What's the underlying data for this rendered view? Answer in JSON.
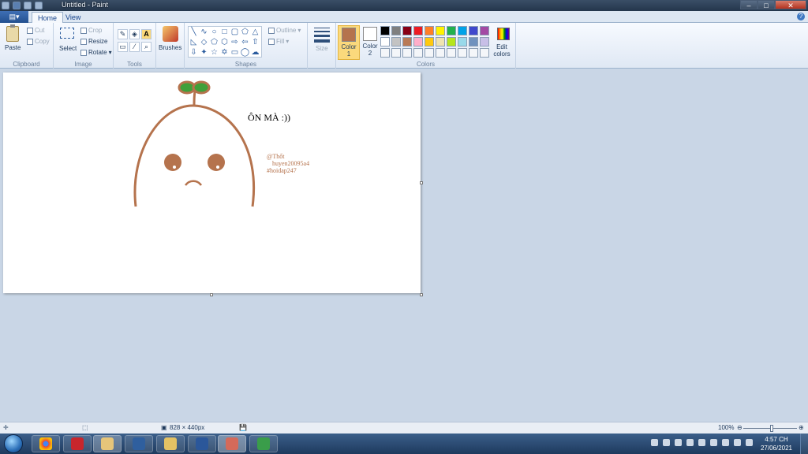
{
  "window": {
    "title": "Untitled - Paint",
    "controls": {
      "minimize": "–",
      "maximize": "□",
      "close": "✕"
    }
  },
  "ribbon_tabs": [
    {
      "label": "Home",
      "active": true
    },
    {
      "label": "View",
      "active": false
    }
  ],
  "clipboard": {
    "paste": "Paste",
    "cut": "Cut",
    "copy": "Copy",
    "group": "Clipboard"
  },
  "image": {
    "select": "Select",
    "crop": "Crop",
    "resize": "Resize",
    "rotate": "Rotate",
    "group": "Image"
  },
  "tools": {
    "group": "Tools",
    "text_tool": "A"
  },
  "brushes": {
    "label": "Brushes"
  },
  "shapes": {
    "group": "Shapes",
    "outline": "Outline",
    "fill": "Fill"
  },
  "size": {
    "label": "Size"
  },
  "colors": {
    "group": "Colors",
    "color1_label": "Color",
    "color1_num": "1",
    "color1_value": "#b5734d",
    "color2_label": "Color",
    "color2_num": "2",
    "color2_value": "#ffffff",
    "edit_label": "Edit",
    "edit_label2": "colors",
    "palette_row1": [
      "#000000",
      "#7f7f7f",
      "#880015",
      "#ed1c24",
      "#ff7f27",
      "#fff200",
      "#22b14c",
      "#00a2e8",
      "#3f48cc",
      "#a349a4"
    ],
    "palette_row2": [
      "#ffffff",
      "#c3c3c3",
      "#b97a57",
      "#ffaec9",
      "#ffc90e",
      "#efe4b0",
      "#b5e61d",
      "#99d9ea",
      "#7092be",
      "#c8bfe7"
    ],
    "palette_row3": [
      "#f4f6f9",
      "#f4f6f9",
      "#f4f6f9",
      "#f4f6f9",
      "#f4f6f9",
      "#f4f6f9",
      "#f4f6f9",
      "#f4f6f9",
      "#f4f6f9",
      "#f4f6f9"
    ]
  },
  "canvas": {
    "drawing_text": "ÔN MÀ :))",
    "mention_1": "@Thốt",
    "mention_2": "huyen20095a4",
    "hashtag": "#hoidap247",
    "stroke_color": "#b5734d",
    "leaf_color": "#3fa03a"
  },
  "status": {
    "image_size": "828 × 440px",
    "zoom": "100%"
  },
  "taskbar": {
    "time": "4:57 CH",
    "date": "27/06/2021"
  }
}
